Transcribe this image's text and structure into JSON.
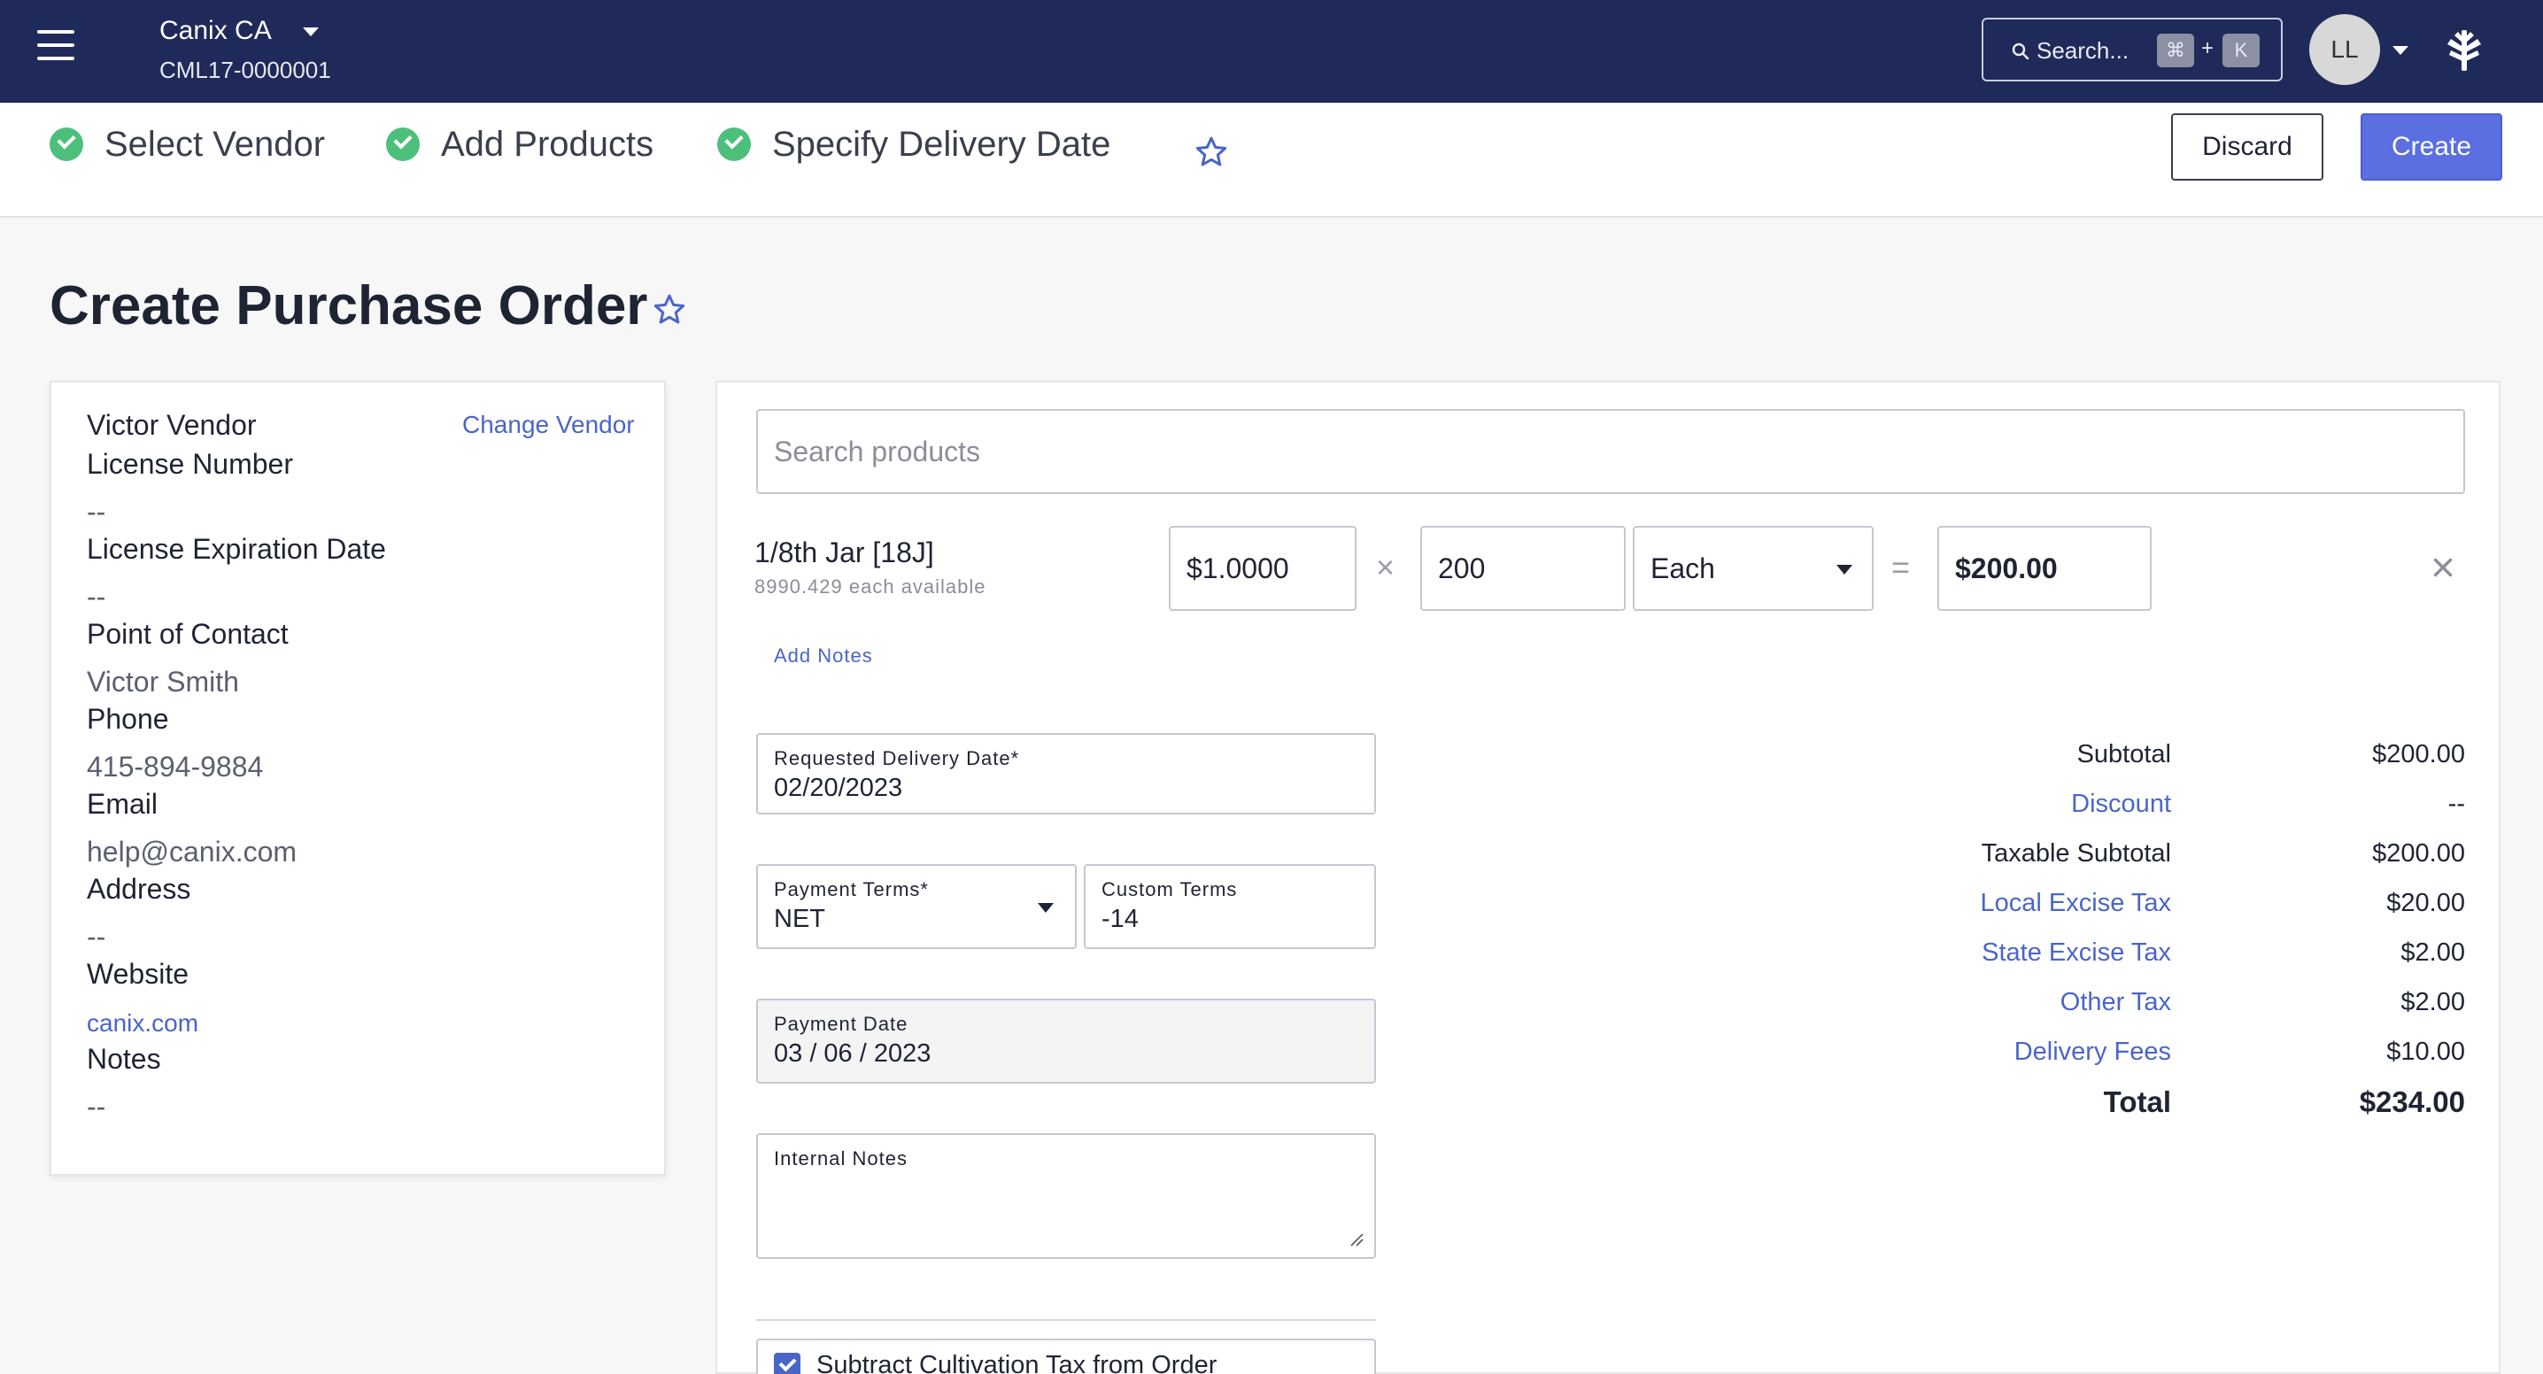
{
  "topbar": {
    "org_name": "Canix CA",
    "org_license": "CML17-0000001",
    "search_placeholder": "Search...",
    "shortcut_cmd": "⌘",
    "shortcut_plus": "+",
    "shortcut_key": "K",
    "avatar_initials": "LL",
    "icons": [
      "menu-icon",
      "chevron-down-icon",
      "search-icon",
      "canix-logo-icon"
    ]
  },
  "stepper": {
    "steps": [
      {
        "label": "Select Vendor",
        "status": "complete"
      },
      {
        "label": "Add Products",
        "status": "complete"
      },
      {
        "label": "Specify Delivery Date",
        "status": "complete"
      }
    ],
    "discard_label": "Discard",
    "create_label": "Create"
  },
  "page": {
    "title": "Create Purchase Order"
  },
  "vendor": {
    "name": "Victor Vendor",
    "change_label": "Change Vendor",
    "license_number_label": "License Number",
    "license_number": "--",
    "license_expiration_label": "License Expiration Date",
    "license_expiration": "--",
    "contact_label": "Point of Contact",
    "contact": "Victor Smith",
    "phone_label": "Phone",
    "phone": "415-894-9884",
    "email_label": "Email",
    "email": "help@canix.com",
    "address_label": "Address",
    "address": "--",
    "website_label": "Website",
    "website": "canix.com",
    "notes_label": "Notes",
    "notes": "--"
  },
  "products": {
    "search_placeholder": "Search products",
    "line_items": [
      {
        "name": "1/8th Jar [18J]",
        "availability": "8990.429 each available",
        "unit_price": "$1.0000",
        "times_symbol": "×",
        "quantity": "200",
        "unit": "Each",
        "equals_symbol": "=",
        "line_total": "$200.00",
        "add_notes_label": "Add Notes"
      }
    ]
  },
  "form": {
    "requested_delivery_label": "Requested Delivery Date*",
    "requested_delivery_value": "02/20/2023",
    "payment_terms_label": "Payment Terms*",
    "payment_terms_value": "NET",
    "custom_terms_label": "Custom Terms",
    "custom_terms_value": "-14",
    "payment_date_label": "Payment Date",
    "payment_date_value": "03 / 06 / 2023",
    "internal_notes_label": "Internal Notes",
    "cultivation_tax_label": "Subtract Cultivation Tax from Order",
    "cultivation_tax_checked": true
  },
  "summary": {
    "rows": [
      {
        "label": "Subtotal",
        "value": "$200.00",
        "link": false
      },
      {
        "label": "Discount",
        "value": "--",
        "link": true
      },
      {
        "label": "Taxable Subtotal",
        "value": "$200.00",
        "link": false
      },
      {
        "label": "Local Excise Tax",
        "value": "$20.00",
        "link": true
      },
      {
        "label": "State Excise Tax",
        "value": "$2.00",
        "link": true
      },
      {
        "label": "Other Tax",
        "value": "$2.00",
        "link": true
      },
      {
        "label": "Delivery Fees",
        "value": "$10.00",
        "link": true
      }
    ],
    "total_label": "Total",
    "total_value": "$234.00"
  },
  "colors": {
    "nav_bg": "#1f2a5a",
    "accent": "#5b6fe0",
    "link": "#4a65c8",
    "success": "#4cc07a"
  }
}
